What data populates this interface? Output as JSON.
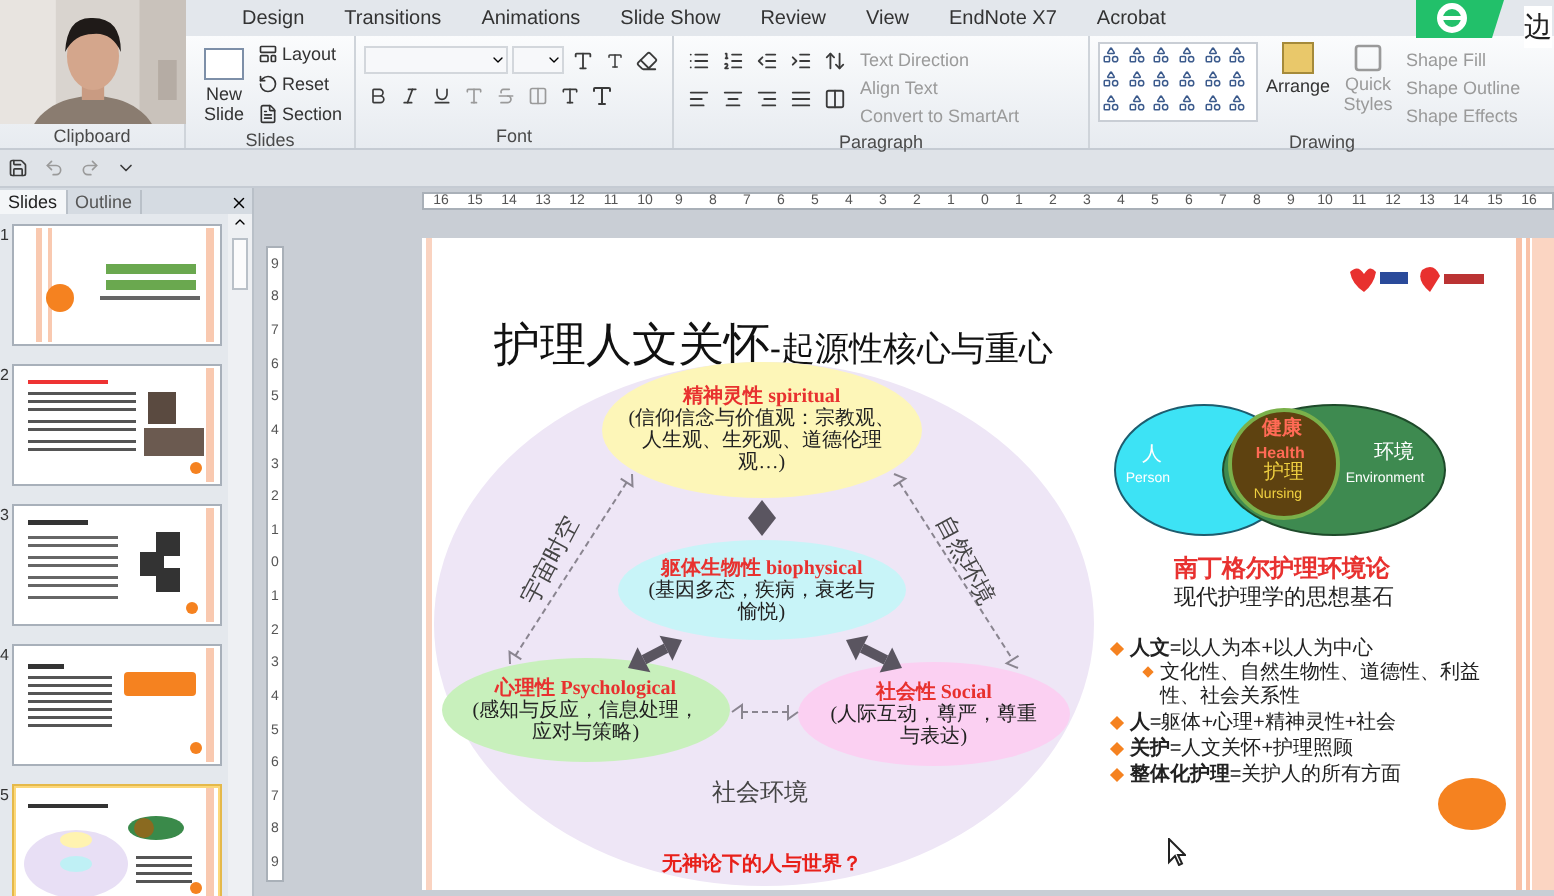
{
  "ribbon": {
    "tabs": [
      "Design",
      "Transitions",
      "Animations",
      "Slide Show",
      "Review",
      "View",
      "EndNote X7",
      "Acrobat"
    ],
    "group_labels": [
      "Clipboard",
      "Slides",
      "Font",
      "Paragraph",
      "Drawing"
    ],
    "slides_group": {
      "new_slide": "New Slide",
      "items": [
        "Layout",
        "Reset",
        "Section"
      ]
    },
    "paragraph_items": [
      {
        "label": "Text Direction",
        "disabled": true
      },
      {
        "label": "Align Text",
        "disabled": true
      },
      {
        "label": "Convert to SmartArt",
        "disabled": true
      }
    ],
    "arrange": "Arrange",
    "quick_styles": {
      "label": "Quick Styles",
      "disabled": true
    },
    "shape_items": [
      {
        "label": "Shape Fill",
        "disabled": true
      },
      {
        "label": "Shape Outline",
        "disabled": true
      },
      {
        "label": "Shape Effects",
        "disabled": true
      }
    ]
  },
  "overlay_badge": {
    "text": "边"
  },
  "pane": {
    "tabs": [
      {
        "label": "Slides",
        "selected": true
      },
      {
        "label": "Outline",
        "selected": false
      }
    ],
    "slides": [
      {
        "number": "1",
        "selected": false
      },
      {
        "number": "2",
        "selected": false
      },
      {
        "number": "3",
        "selected": false
      },
      {
        "number": "4",
        "selected": false
      },
      {
        "number": "5",
        "selected": true
      }
    ]
  },
  "rulers": {
    "horizontal": [
      "16",
      "15",
      "14",
      "13",
      "12",
      "11",
      "10",
      "9",
      "8",
      "7",
      "6",
      "5",
      "4",
      "3",
      "2",
      "1",
      "0",
      "1",
      "2",
      "3",
      "4",
      "5",
      "6",
      "7",
      "8",
      "9",
      "10",
      "11",
      "12",
      "13",
      "14",
      "15",
      "16"
    ],
    "vertical": [
      "9",
      "8",
      "7",
      "6",
      "5",
      "4",
      "3",
      "2",
      "1",
      "0",
      "1",
      "2",
      "3",
      "4",
      "5",
      "6",
      "7",
      "8",
      "9"
    ]
  },
  "slide": {
    "title": {
      "main": "护理人文关怀",
      "sub": "-起源性核心与重心"
    },
    "nodes": [
      {
        "kind": "spiritual",
        "title": "精神灵性 spiritual",
        "note": "(信仰信念与价值观：宗教观、人生观、生死观、道德伦理观…)"
      },
      {
        "kind": "biophysical",
        "title": "躯体生物性 biophysical",
        "note": "(基因多态，疾病，衰老与愉悦)"
      },
      {
        "kind": "psychological",
        "title": "心理性 Psychological",
        "note": "(感知与反应，信息处理，应对与策略)"
      },
      {
        "kind": "social",
        "title": "社会性 Social",
        "note": "(人际互动，尊严，尊重与表达)"
      }
    ],
    "side_labels": [
      "宇宙时空",
      "自然环境"
    ],
    "bottom_label": "社会环境",
    "question": "无神论下的人与世界？",
    "venn": {
      "person": "人",
      "person_en": "Person",
      "health": "健康",
      "health_en": "Health",
      "nursing": "护理",
      "nursing_en": "Nursing",
      "environment": "环境",
      "environment_en": "Environment"
    },
    "theory_title": "南丁格尔护理环境论",
    "theory_subtitle": "现代护理学的思想基石",
    "bullets": [
      {
        "text": "**人文**=以人为本+以人为中心",
        "children": [
          {
            "text": "文化性、自然生物性、道德性、利益性、社会关系性"
          }
        ]
      },
      {
        "text": "**人**=躯体+心理+精神灵性+社会"
      },
      {
        "text": "**关护**=人文关怀+护理照顾"
      },
      {
        "text": "**整体化护理**=关护人的所有方面"
      }
    ]
  }
}
